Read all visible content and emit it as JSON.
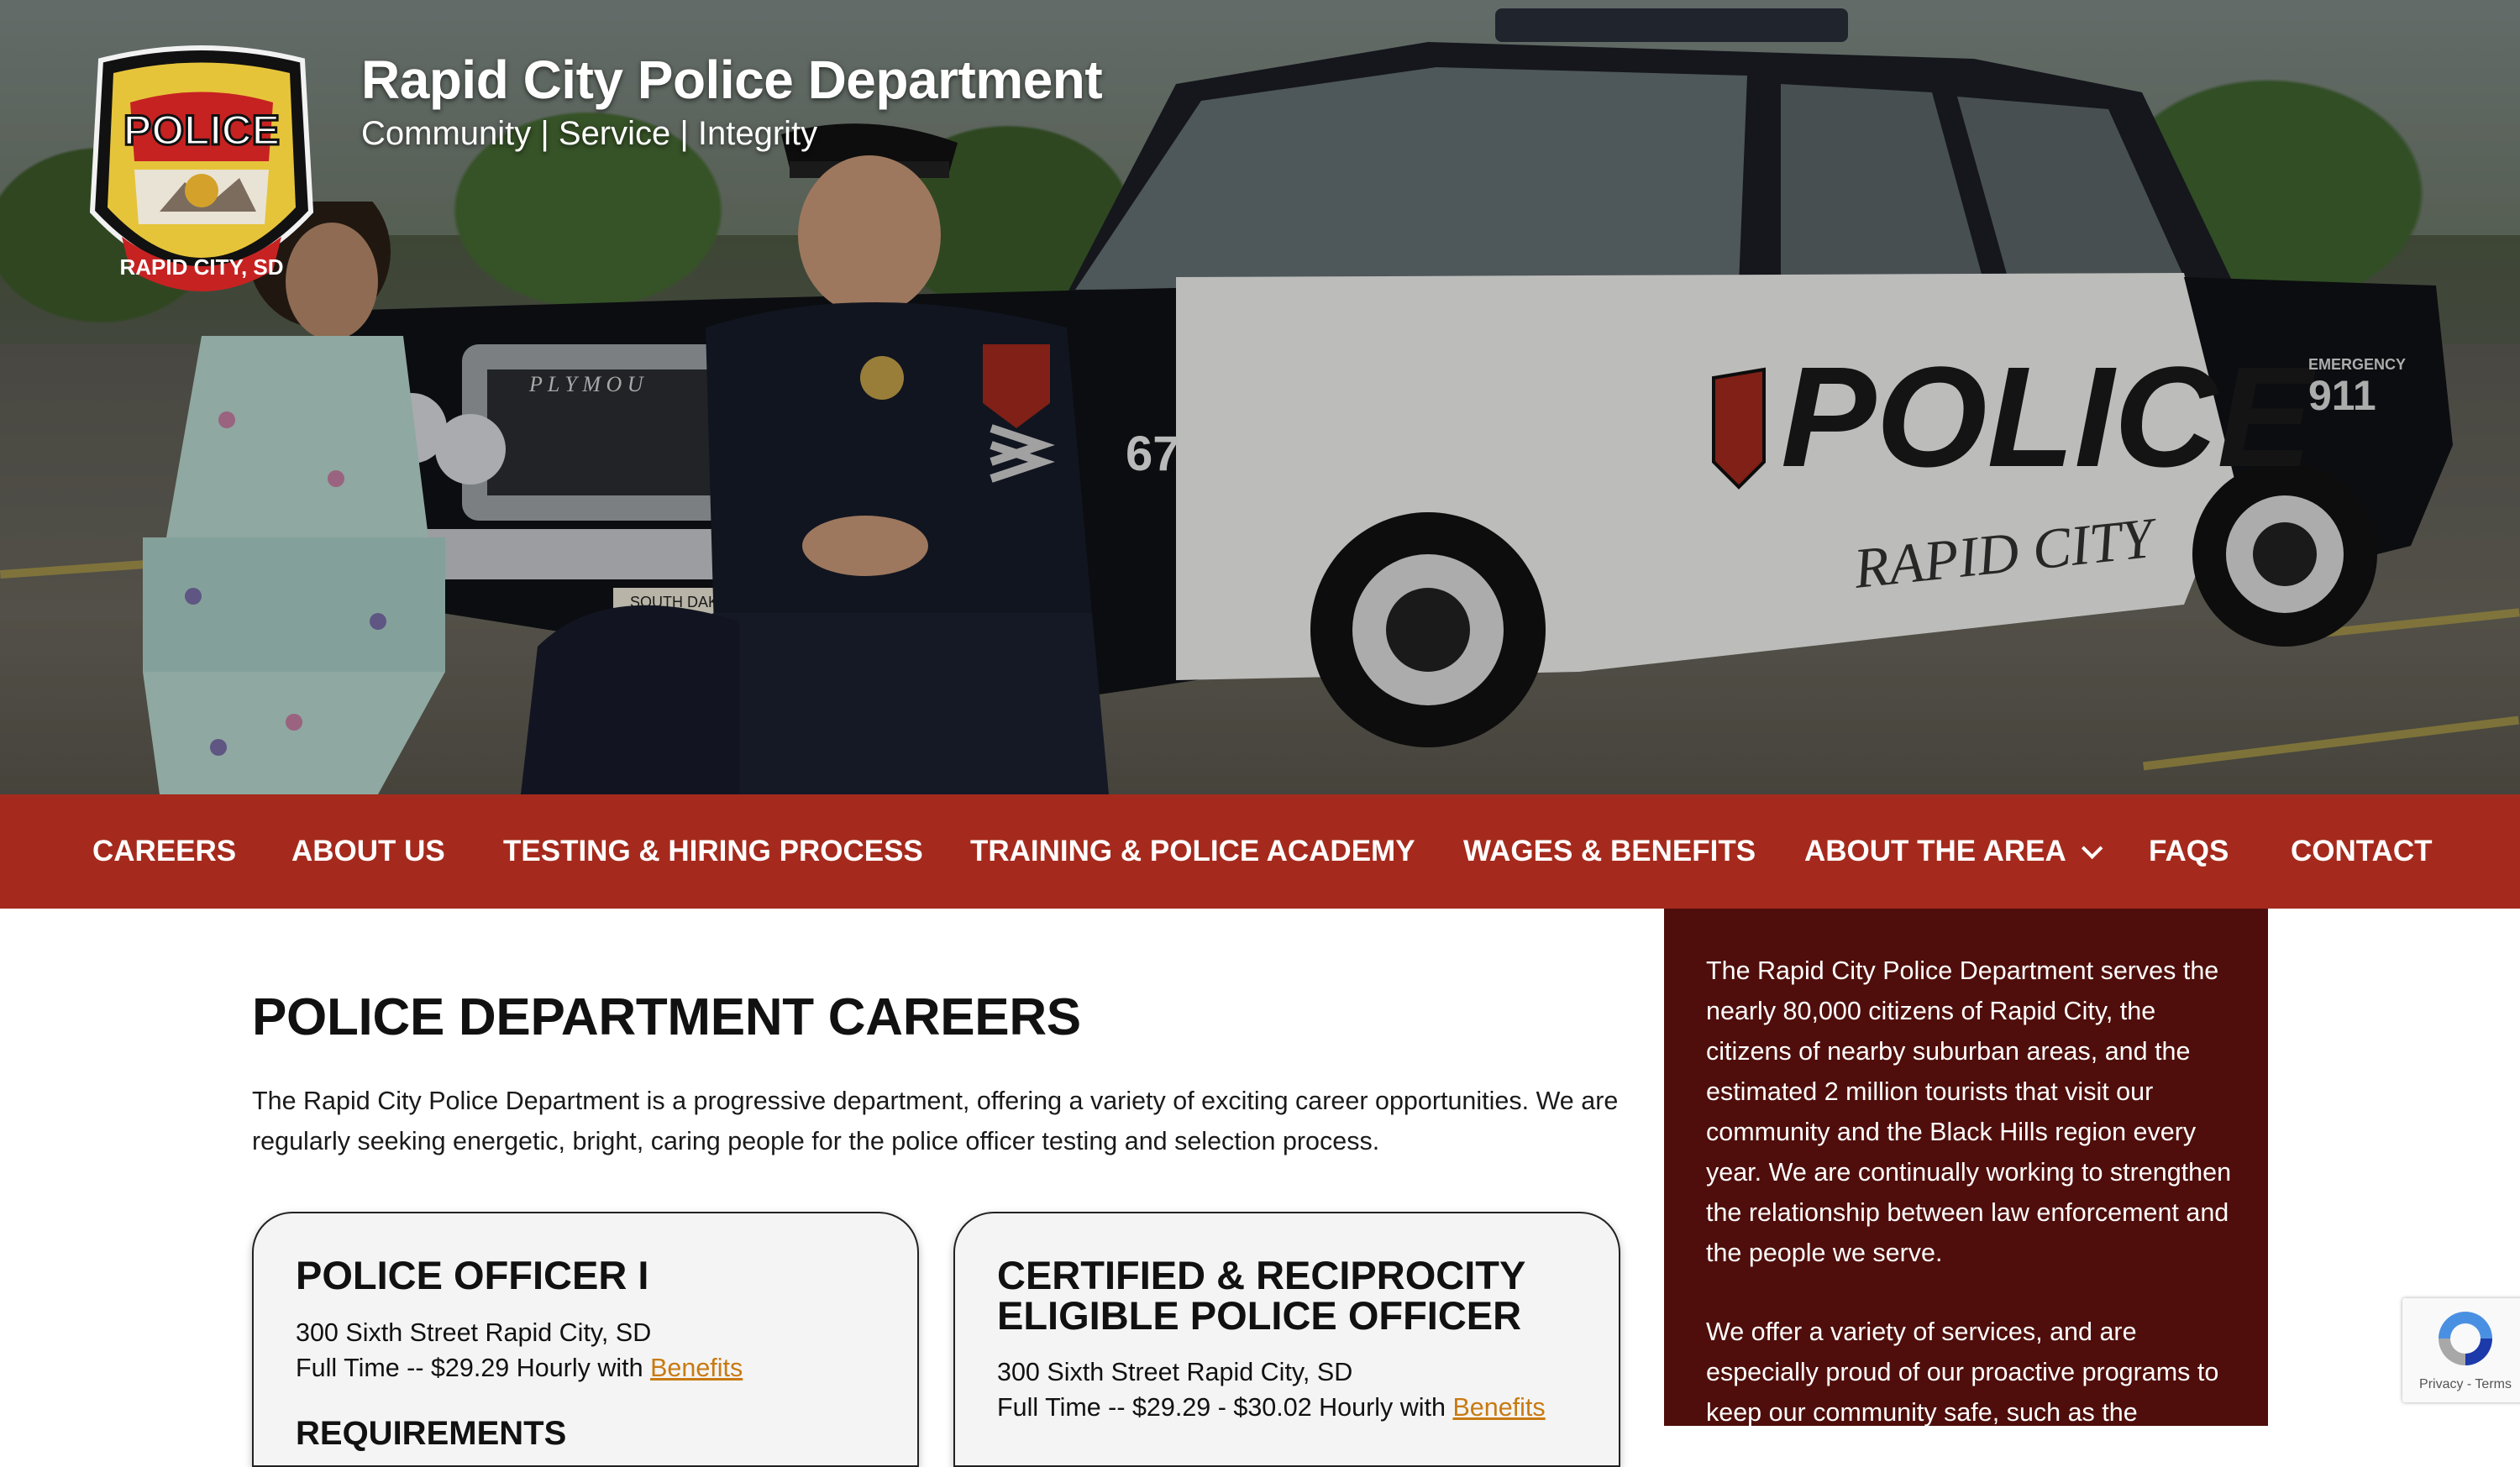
{
  "site": {
    "title": "Rapid City Police Department",
    "tagline": "Community | Service | Integrity",
    "badge_top_text": "POLICE",
    "badge_bottom_text": "RAPID CITY, SD"
  },
  "hero": {
    "car_door_text": "POLICE",
    "car_door_subtext": "RAPID CITY",
    "car_number": "67",
    "car_emergency_label": "EMERGENCY",
    "car_emergency_number": "911",
    "grille_text": "P L Y M O U",
    "plate_text": "SOUTH DAKOTA"
  },
  "nav": {
    "items": [
      {
        "label": "CAREERS"
      },
      {
        "label": "ABOUT US"
      },
      {
        "label": "TESTING & HIRING PROCESS"
      },
      {
        "label": "TRAINING & POLICE ACADEMY"
      },
      {
        "label": "WAGES & BENEFITS"
      },
      {
        "label": "ABOUT THE AREA"
      },
      {
        "label": "FAQS"
      },
      {
        "label": "CONTACT"
      }
    ]
  },
  "main": {
    "title": "POLICE DEPARTMENT CAREERS",
    "intro": "The Rapid City Police Department is a progressive department, offering a variety of exciting career opportunities. We are regularly seeking energetic, bright, caring people for the police officer testing and selection process.",
    "cards": [
      {
        "title": "POLICE OFFICER I",
        "address": "300 Sixth Street Rapid City, SD",
        "pay_prefix": "Full Time -- $29.29 Hourly with ",
        "benefits_link": "Benefits",
        "requirements_heading": "REQUIREMENTS"
      },
      {
        "title": "CERTIFIED & RECIPROCITY ELIGIBLE POLICE OFFICER",
        "address": "300 Sixth Street Rapid City, SD",
        "pay_prefix": "Full Time -- $29.29 - $30.02 Hourly with ",
        "benefits_link": "Benefits"
      }
    ]
  },
  "sidebar": {
    "paragraph_1": "The Rapid City Police Department serves the nearly 80,000 citizens of Rapid City, the citizens of nearby suburban areas, and the estimated 2 million tourists that visit our community and the Black Hills region every year. We are continually working to strengthen the relationship between law enforcement and the people we serve.",
    "paragraph_2": "We offer a variety of services, and are especially proud of our proactive programs to keep our community safe, such as the"
  },
  "recaptcha": {
    "links": "Privacy - Terms"
  },
  "colors": {
    "nav_bg": "#a52a1d",
    "sidebar_bg": "#4f0e0b",
    "link": "#c87a12"
  }
}
